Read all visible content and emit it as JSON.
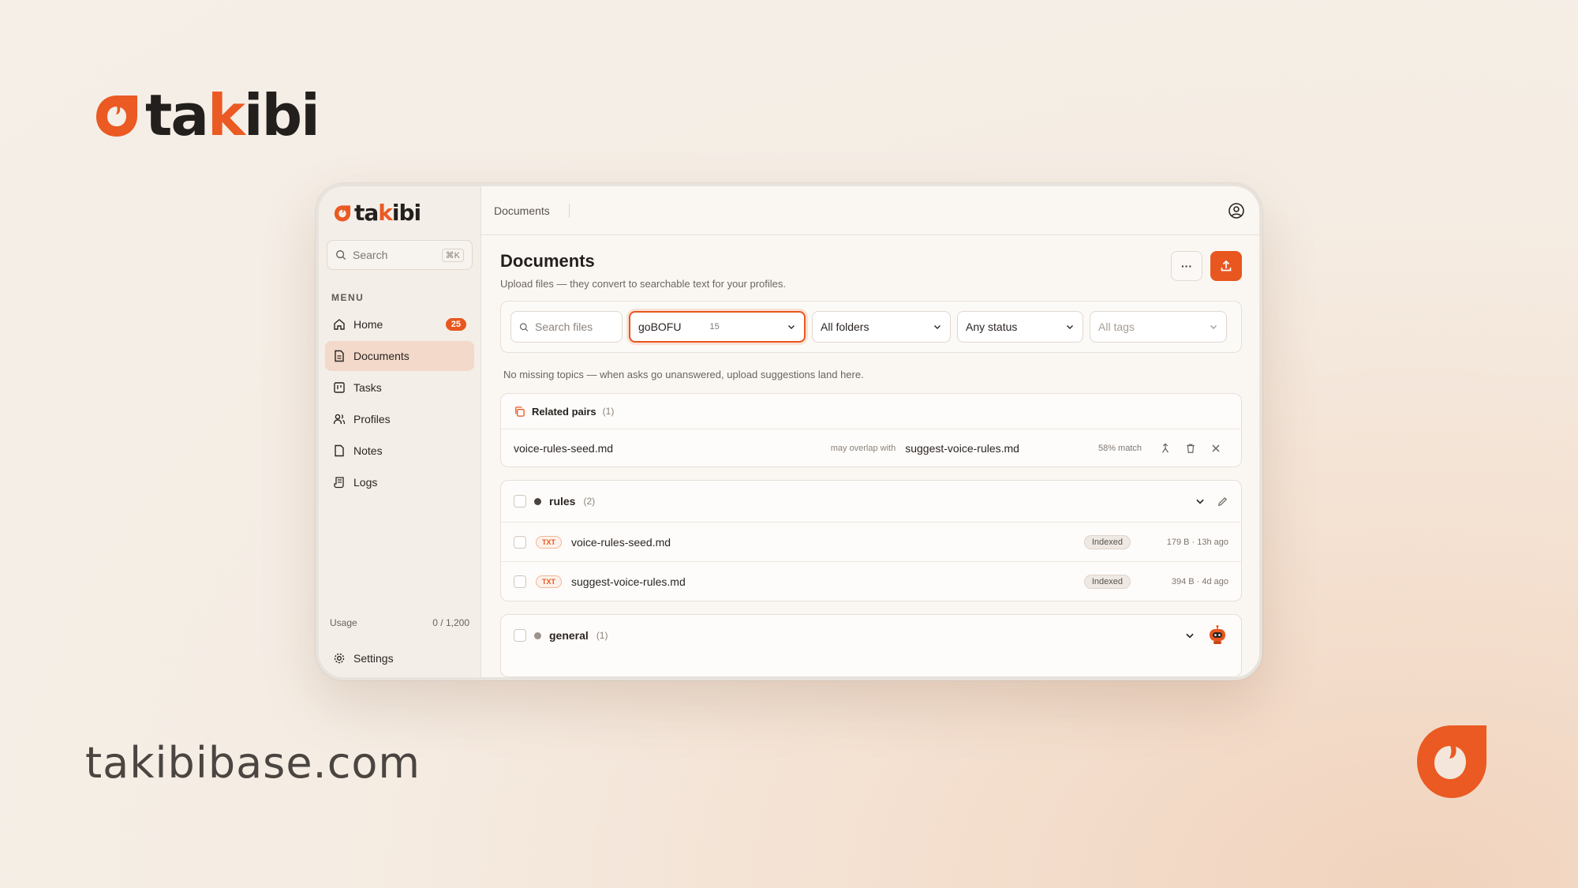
{
  "brand": {
    "name_parts": [
      "ta",
      "k",
      "ibi"
    ],
    "domain": "takibibase.com",
    "accent_color": "#e8571f"
  },
  "sidebar": {
    "search_placeholder": "Search",
    "search_shortcut": "⌘K",
    "menu_label": "MENU",
    "items": [
      {
        "label": "Home",
        "icon": "home-icon",
        "badge": "25"
      },
      {
        "label": "Documents",
        "icon": "document-icon",
        "active": true
      },
      {
        "label": "Tasks",
        "icon": "kanban-icon"
      },
      {
        "label": "Profiles",
        "icon": "users-icon"
      },
      {
        "label": "Notes",
        "icon": "note-icon"
      },
      {
        "label": "Logs",
        "icon": "scroll-icon"
      }
    ],
    "usage_label": "Usage",
    "usage_value": "0 / 1,200",
    "settings_label": "Settings"
  },
  "topbar": {
    "breadcrumb": "Documents",
    "user_icon": "user-circle-icon"
  },
  "page": {
    "title": "Documents",
    "subtitle": "Upload files — they convert to searchable text for your profiles.",
    "more_label": "···",
    "upload_icon": "upload-icon"
  },
  "filters": {
    "search_placeholder": "Search files",
    "profile_value": "goBOFU",
    "profile_count": "15",
    "folder_value": "All folders",
    "status_value": "Any status",
    "tags_value": "All tags"
  },
  "hint": "No missing topics — when asks go unanswered, upload suggestions land here.",
  "related_pairs": {
    "title": "Related pairs",
    "count": "(1)",
    "pairs": [
      {
        "left": "voice-rules-seed.md",
        "overlap_text": "may overlap with",
        "right": "suggest-voice-rules.md",
        "match": "58% match"
      }
    ]
  },
  "groups": [
    {
      "name": "rules",
      "count": "(2)",
      "dot_color": "#4a4440",
      "files": [
        {
          "type": "TXT",
          "name": "voice-rules-seed.md",
          "status": "Indexed",
          "meta": "179 B · 13h ago"
        },
        {
          "type": "TXT",
          "name": "suggest-voice-rules.md",
          "status": "Indexed",
          "meta": "394 B · 4d ago"
        }
      ]
    },
    {
      "name": "general",
      "count": "(1)",
      "dot_color": "#9b928b",
      "files": []
    }
  ]
}
